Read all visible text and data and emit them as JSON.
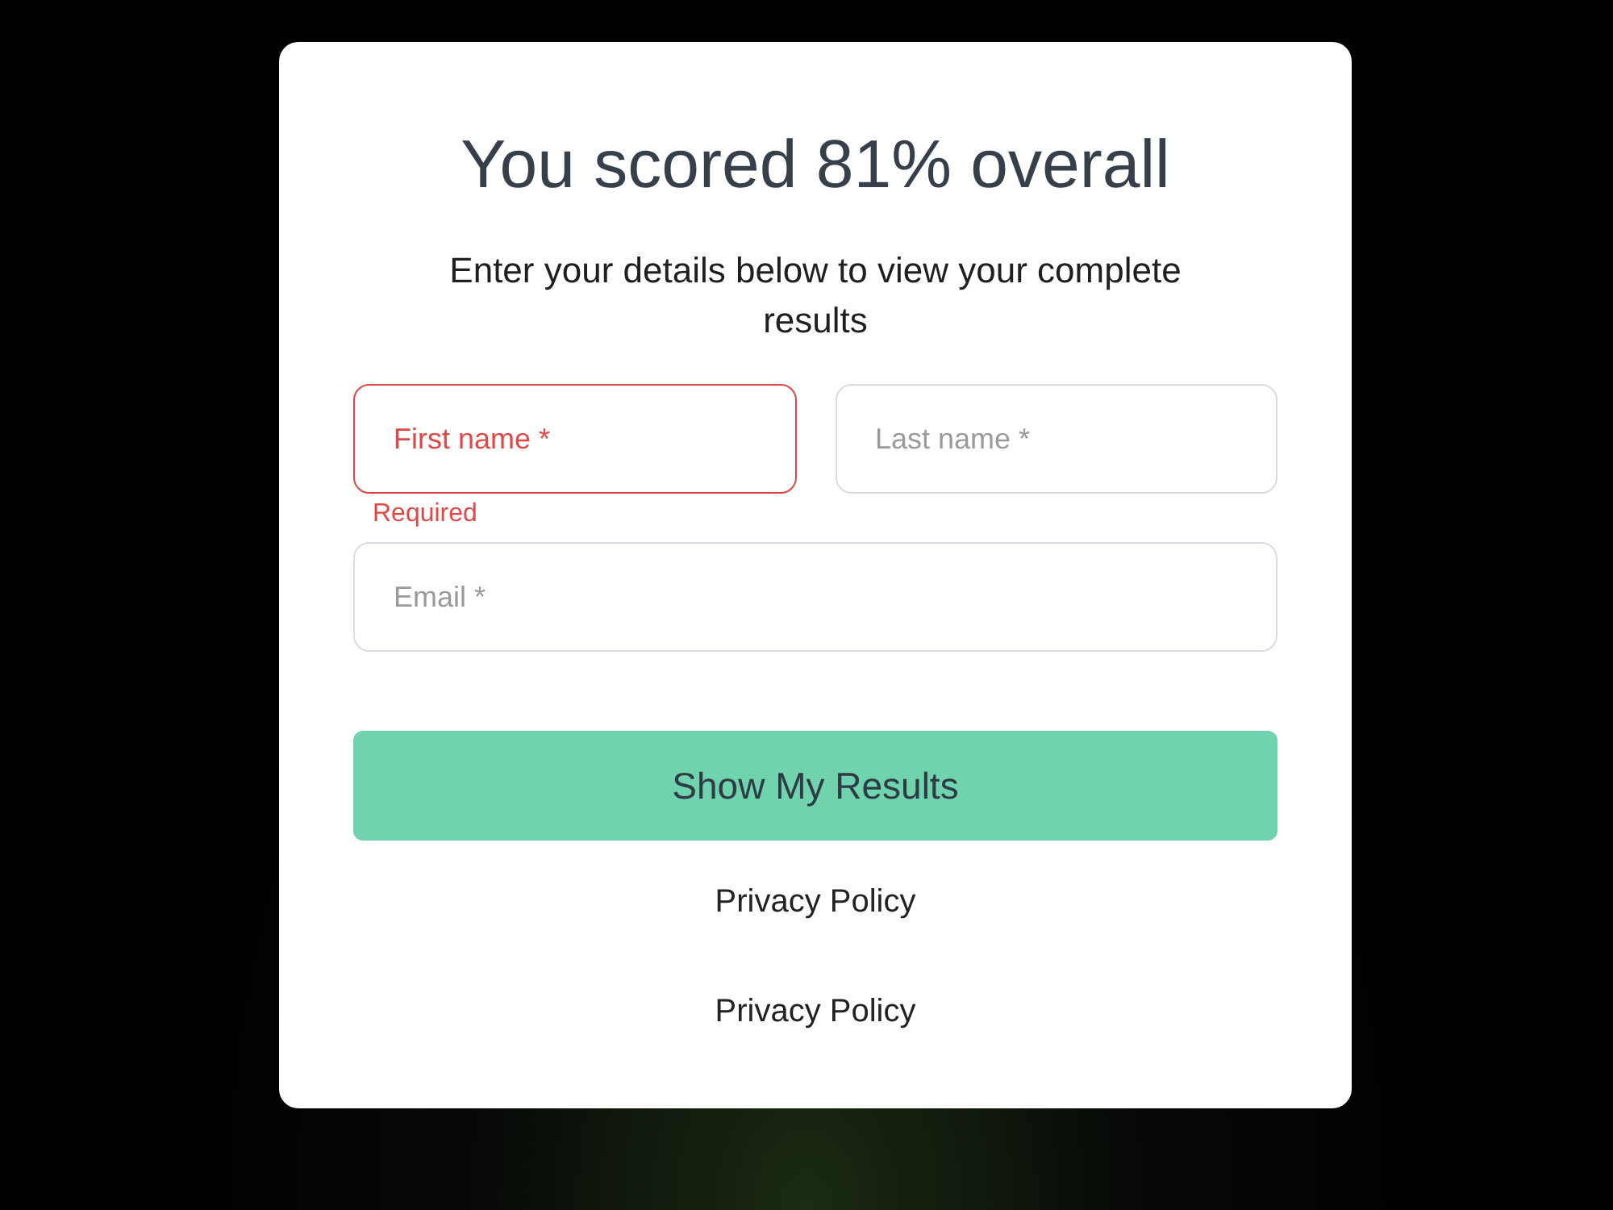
{
  "title": "You scored 81% overall",
  "subtitle": "Enter your details below to view your complete results",
  "rows": [
    {
      "fields": [
        {
          "placeholder": "First name *",
          "error": true,
          "error_text": "Required"
        },
        {
          "placeholder": "Last name *",
          "error": false
        }
      ]
    },
    {
      "fields": [
        {
          "placeholder": "Email *",
          "error": false
        }
      ]
    }
  ],
  "submit_button": {
    "label": "Show My Results"
  },
  "links": [
    "Privacy Policy",
    "Privacy Policy"
  ]
}
